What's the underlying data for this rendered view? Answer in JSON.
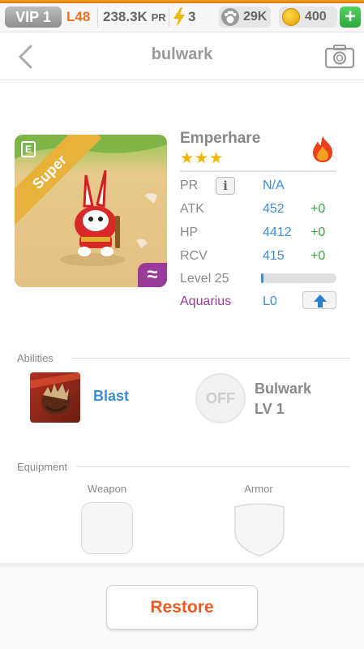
{
  "status": {
    "vip": "VIP 1",
    "level": "L48",
    "pr_value": "238.3K",
    "pr_unit": "PR",
    "energy": "3",
    "paw": "29K",
    "coins": "400",
    "add": "+"
  },
  "header": {
    "title": "bulwark"
  },
  "monster": {
    "name": "Emperhare",
    "stars": "★★★",
    "rarity": "Super",
    "evolve_mark": "E",
    "wave_mark": "≈",
    "element": "fire"
  },
  "stats": {
    "pr": {
      "label": "PR",
      "value": "N/A",
      "info": "i"
    },
    "atk": {
      "label": "ATK",
      "value": "452",
      "bonus": "+0"
    },
    "hp": {
      "label": "HP",
      "value": "4412",
      "bonus": "+0"
    },
    "rcv": {
      "label": "RCV",
      "value": "415",
      "bonus": "+0"
    },
    "level": {
      "label": "Level 25",
      "progress": 0.02
    },
    "sign": {
      "label": "Aquarius",
      "value": "L0"
    }
  },
  "abilities": {
    "label": "Abilities",
    "active": {
      "name": "Blast"
    },
    "leader": {
      "state": "OFF",
      "name": "Bulwark",
      "level": "LV 1"
    }
  },
  "equipment": {
    "label": "Equipment",
    "weapon": "Weapon",
    "armor": "Armor"
  },
  "actions": {
    "restore": "Restore"
  },
  "colors": {
    "accent_blue": "#3c8fd8",
    "bonus_green": "#3aa844",
    "restore_orange": "#ee5a24",
    "sign_purple": "#9a3a9a"
  }
}
